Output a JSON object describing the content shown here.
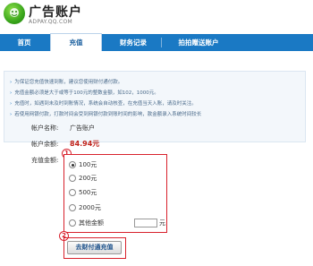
{
  "header": {
    "title": "广告账户",
    "subtitle": "ADPAY.QQ.COM",
    "logo_icon": "qq-ad-logo-icon"
  },
  "nav": {
    "tabs": [
      {
        "label": "首页",
        "active": false
      },
      {
        "label": "充值",
        "active": true
      },
      {
        "label": "财务记录",
        "active": false
      },
      {
        "label": "拍拍赠送账户",
        "active": false
      }
    ]
  },
  "notice": {
    "lines": [
      "为保证您充值快速到账，建议您使用财付通付款。",
      "充值金额必须是大于或等于100元的整数金额，如102，1000元。",
      "充值时，如遇到未及时到账情况，系统会自动核查，在充值当天入账，请及时关注。",
      "若使用网银付款，打款时间会受到网银付款到账时间的影响，款金额录入系统时间较长"
    ]
  },
  "account": {
    "name_label": "帐户名称:",
    "name_value": "广告账户",
    "balance_label": "帐户余额:",
    "balance_value": "84.94元"
  },
  "recharge": {
    "amount_label": "充值金额:",
    "options": [
      "100元",
      "200元",
      "500元",
      "2000元",
      "其他金额"
    ],
    "selected_index": 0,
    "other_unit": "元",
    "other_value": ""
  },
  "markers": {
    "one": "1",
    "two": "2"
  },
  "submit": {
    "label": "去财付通充值"
  },
  "colors": {
    "nav_bg": "#1a79c4",
    "highlight_red": "#d8212c",
    "balance_red": "#c0231b"
  }
}
